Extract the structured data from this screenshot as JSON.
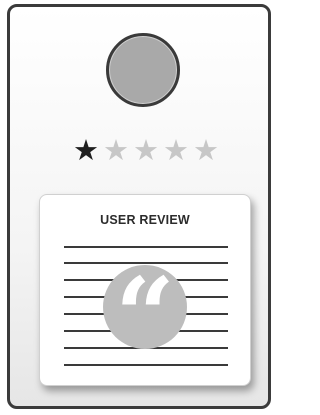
{
  "review": {
    "title": "USER REVIEW",
    "quote_glyph": "“"
  },
  "rating": {
    "value": 1,
    "max": 5,
    "filled_color": "#1f1f1f",
    "empty_color": "#c7c7c7"
  },
  "colors": {
    "border": "#3b3b3b",
    "avatar_fill": "#a9a9a9",
    "line": "#3a3a3a",
    "quote_bg": "#bdbdbd"
  }
}
